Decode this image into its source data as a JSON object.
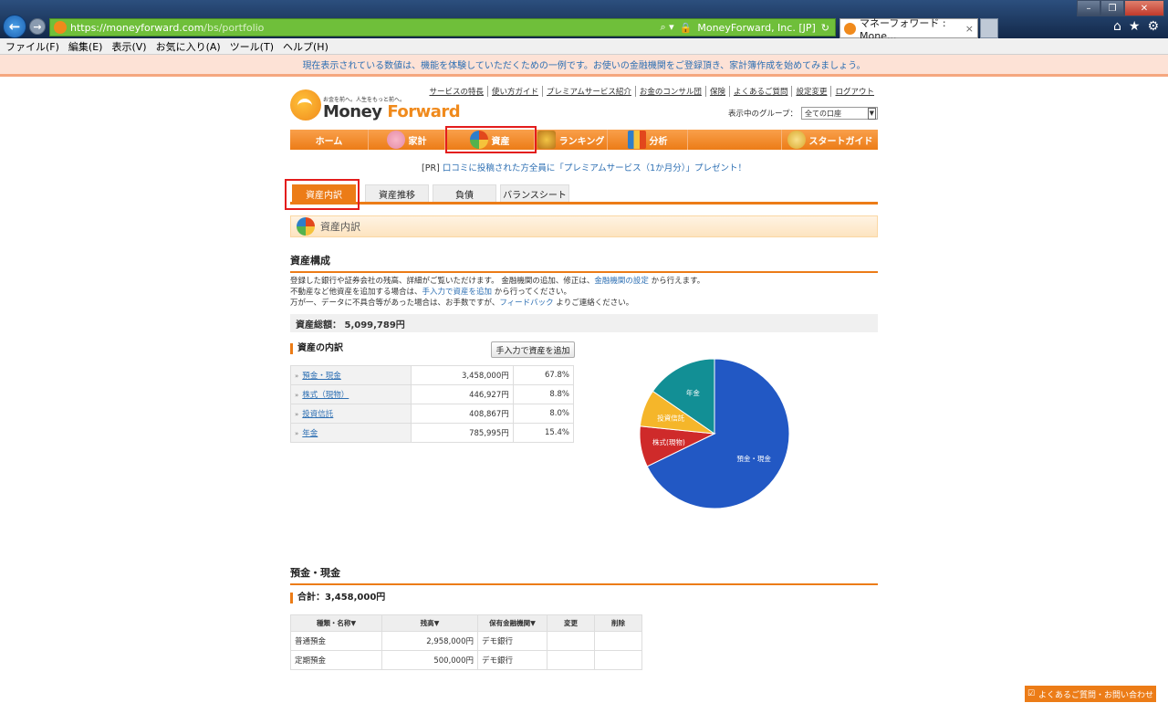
{
  "browser": {
    "url_host": "https://moneyforward.com",
    "url_path": "/bs/portfolio",
    "site_identity": "MoneyForward, Inc. [JP]",
    "tab_title": "マネーフォワード : Mone...",
    "menu": [
      "ファイル(F)",
      "編集(E)",
      "表示(V)",
      "お気に入り(A)",
      "ツール(T)",
      "ヘルプ(H)"
    ]
  },
  "notice": "現在表示されている数値は、機能を体験していただくための一例です。お使いの金融機関をご登録頂き、家計簿作成を始めてみましょう。",
  "logo": {
    "tagline": "お金を前へ。人生をもっと前へ。",
    "name_a": "Money",
    "name_b": "Forward"
  },
  "toplinks": [
    "サービスの特長",
    "使い方ガイド",
    "プレミアムサービス紹介",
    "お金のコンサル団",
    "保険",
    "よくあるご質問",
    "設定変更",
    "ログアウト"
  ],
  "group": {
    "label": "表示中のグループ：",
    "value": "全ての口座"
  },
  "mainnav": [
    "ホーム",
    "家計",
    "資産",
    "ランキング",
    "分析",
    "スタートガイド"
  ],
  "pr": {
    "prefix": "[PR]",
    "link": "口コミに投稿された方全員に「プレミアムサービス（1か月分）」プレゼント！"
  },
  "subtabs": [
    "資産内訳",
    "資産推移",
    "負債",
    "バランスシート"
  ],
  "section_title": "資産内訳",
  "composition": {
    "heading": "資産構成",
    "desc1_a": "登録した銀行や証券会社の残高、詳細がご覧いただけます。 金融機関の追加、修正は、",
    "desc1_link": "金融機関の設定",
    "desc1_b": "から行えます。",
    "desc2_a": "不動産など他資産を追加する場合は、",
    "desc2_link": "手入力で資産を追加",
    "desc2_b": "から行ってください。",
    "desc3_a": "万が一、データに不具合等があった場合は、お手数ですが、",
    "desc3_link": "フィードバック",
    "desc3_b": "よりご連絡ください。",
    "total": "資産総額：  5,099,789円"
  },
  "breakdown": {
    "heading": "資産の内訳",
    "add_button": "手入力で資産を追加",
    "rows": [
      {
        "name": "預金・現金",
        "amount": "3,458,000円",
        "pct": "67.8%"
      },
      {
        "name": "株式（現物）",
        "amount": "446,927円",
        "pct": "8.8%"
      },
      {
        "name": "投資信託",
        "amount": "408,867円",
        "pct": "8.0%"
      },
      {
        "name": "年金",
        "amount": "785,995円",
        "pct": "15.4%"
      }
    ]
  },
  "chart_data": {
    "type": "pie",
    "categories": [
      "預金・現金",
      "株式(現物)",
      "投資信託",
      "年金"
    ],
    "values": [
      67.8,
      8.8,
      8.0,
      15.4
    ],
    "colors": [
      "#2258c4",
      "#cf2a2a",
      "#f5b62a",
      "#128f95"
    ]
  },
  "deposits": {
    "heading": "預金・現金",
    "total": "合計：3,458,000円",
    "columns": [
      "種類・名称▼",
      "残高▼",
      "保有金融機関▼",
      "変更",
      "削除"
    ],
    "rows": [
      {
        "type": "普通預金",
        "balance": "2,958,000円",
        "bank": "デモ銀行"
      },
      {
        "type": "定期預金",
        "balance": "500,000円",
        "bank": "デモ銀行"
      }
    ]
  },
  "faq_button": "よくあるご質問・お問い合わせ"
}
